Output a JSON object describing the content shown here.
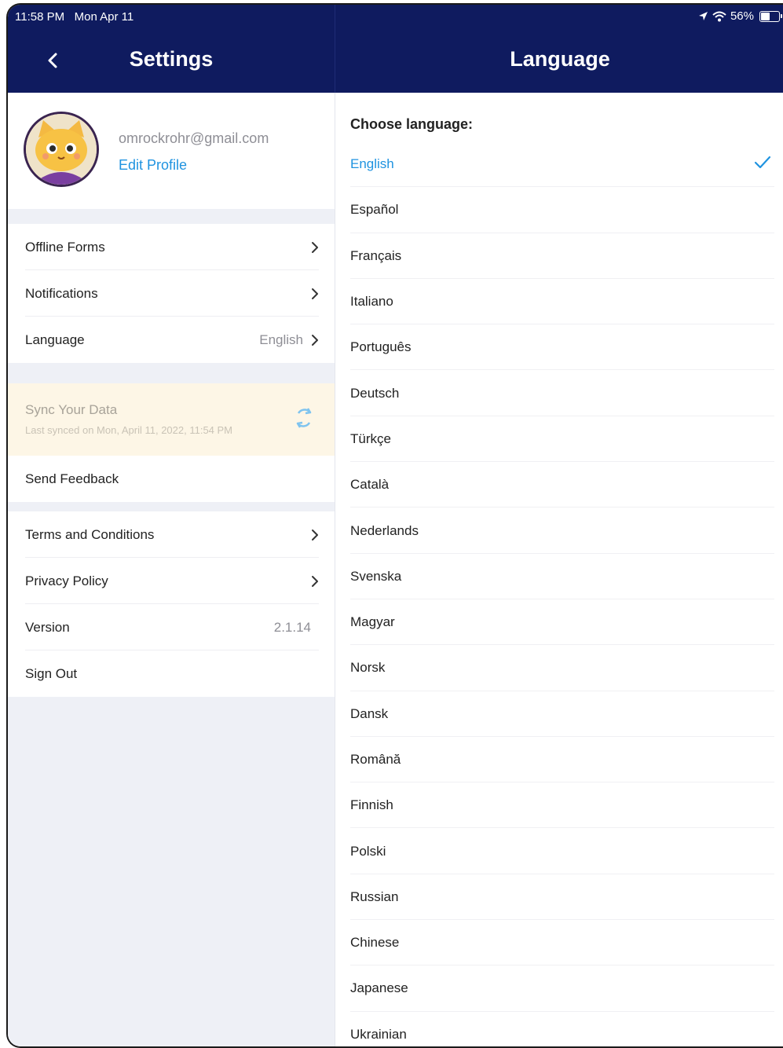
{
  "status_bar": {
    "time": "11:58 PM",
    "date": "Mon Apr 11",
    "battery": "56%",
    "battery_level": 0.56
  },
  "settings": {
    "title": "Settings",
    "profile": {
      "email": "omrockrohr@gmail.com",
      "edit_label": "Edit Profile"
    },
    "group1": [
      {
        "label": "Offline Forms",
        "value": "",
        "chevron": true
      },
      {
        "label": "Notifications",
        "value": "",
        "chevron": true
      },
      {
        "label": "Language",
        "value": "English",
        "chevron": true
      }
    ],
    "sync": {
      "title": "Sync Your Data",
      "subtitle": "Last synced on Mon, April 11, 2022, 11:54 PM"
    },
    "feedback": {
      "label": "Send Feedback"
    },
    "group3": [
      {
        "label": "Terms and Conditions",
        "value": "",
        "chevron": true
      },
      {
        "label": "Privacy Policy",
        "value": "",
        "chevron": true
      },
      {
        "label": "Version",
        "value": "2.1.14",
        "chevron": false
      },
      {
        "label": "Sign Out",
        "value": "",
        "chevron": false
      }
    ]
  },
  "language": {
    "title": "Language",
    "prompt": "Choose language:",
    "selected": "English",
    "options": [
      "English",
      "Español",
      "Français",
      "Italiano",
      "Português",
      "Deutsch",
      "Türkçe",
      "Català",
      "Nederlands",
      "Svenska",
      "Magyar",
      "Norsk",
      "Dansk",
      "Română",
      "Finnish",
      "Polski",
      "Russian",
      "Chinese",
      "Japanese",
      "Ukrainian"
    ]
  },
  "colors": {
    "nav_bg": "#0f1b5f",
    "accent": "#1f93e0",
    "sync_bg": "#fdf6e6"
  }
}
